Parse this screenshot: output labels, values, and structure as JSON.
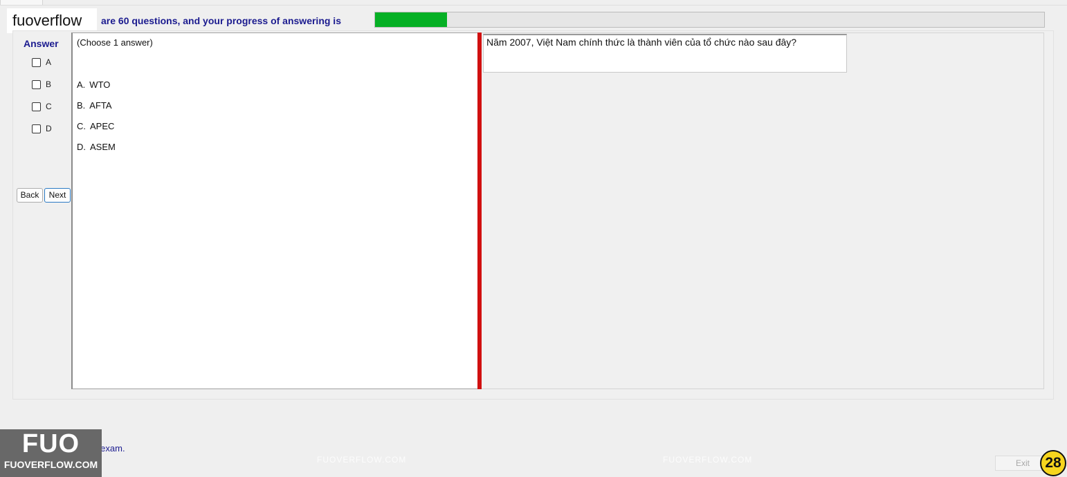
{
  "brand": {
    "name": "fuoverflow"
  },
  "progress": {
    "text": "are 60 questions, and your progress of answering is",
    "fraction": 0.108,
    "color": "#06b025"
  },
  "answer_panel": {
    "heading": "Answer",
    "options": [
      "A",
      "B",
      "C",
      "D"
    ],
    "back_label": "Back",
    "next_label": "Next"
  },
  "question": {
    "hint": "(Choose 1 answer)",
    "choices": [
      {
        "letter": "A.",
        "text": "WTO"
      },
      {
        "letter": "B.",
        "text": "AFTA"
      },
      {
        "letter": "C.",
        "text": "APEC"
      },
      {
        "letter": "D.",
        "text": "ASEM"
      }
    ],
    "text": "Năm 2007, Việt Nam chính thức là thành viên của tổ chức nào sau đây?"
  },
  "watermark": {
    "text": "FUOVERFLOW.COM"
  },
  "footer": {
    "finish_text": "want to finish the exam.",
    "exit_label": "Exit",
    "badge": "28"
  },
  "logo": {
    "big": "FUO",
    "small": "FUOVERFLOW.COM"
  },
  "colors": {
    "splitter": "#d01010",
    "heading": "#1b1b8f",
    "badge": "#f7d51e"
  }
}
